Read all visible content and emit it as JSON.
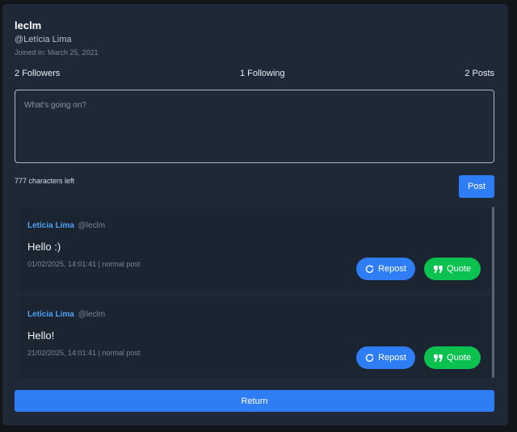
{
  "profile": {
    "username": "leclm",
    "handle": "@Letícia Lima",
    "joined": "Joined in: March 25, 2021"
  },
  "stats": {
    "followers": "2 Followers",
    "following": "1 Following",
    "posts": "2 Posts"
  },
  "composer": {
    "placeholder": "What's going on?",
    "value": "",
    "chars_left": "777 characters left",
    "post_label": "Post"
  },
  "feed": [
    {
      "author": "Letícia Lima",
      "handle": "@leclm",
      "text": "Hello :)",
      "meta": "01/02/2025, 14:01:41 | normal post",
      "repost_label": "Repost",
      "quote_label": "Quote"
    },
    {
      "author": "Letícia Lima",
      "handle": "@leclm",
      "text": "Hello!",
      "meta": "21/02/2025, 14:01:41 | normal post",
      "repost_label": "Repost",
      "quote_label": "Quote"
    }
  ],
  "return_label": "Return",
  "colors": {
    "panel": "#1e2836",
    "accent_blue": "#2e7df5",
    "accent_green": "#0bc251",
    "author_link": "#4ea3f5"
  },
  "icons": {
    "repost": "repost-icon",
    "quote": "quote-icon"
  }
}
